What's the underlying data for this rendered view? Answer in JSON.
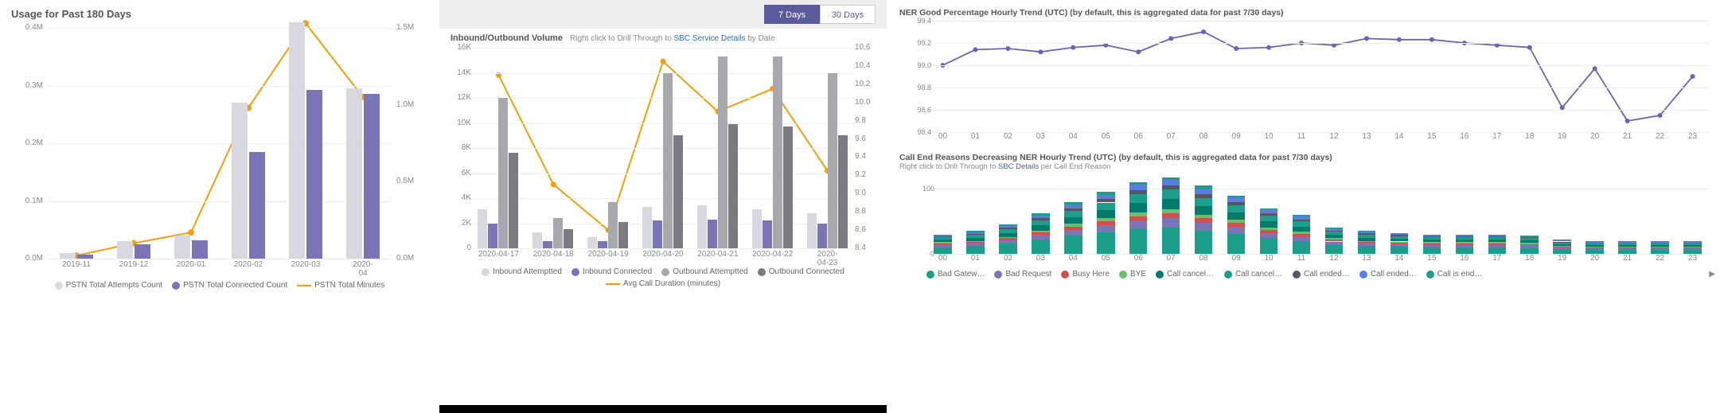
{
  "colors": {
    "barLight": "#d9d7e0",
    "barPurple": "#7b74b7",
    "line": "#f59e0b",
    "greyMid": "#a8a7ae",
    "greyDark": "#7a7a82",
    "teal": "#1b9e8a",
    "tealDark": "#007b6e",
    "red": "#d05050",
    "green": "#6bbf6b",
    "blue": "#5a7dde",
    "yellow": "#e6c13c",
    "slate": "#556",
    "purpleLine": "#6b63b5"
  },
  "panelA": {
    "title": "Usage for Past 180 Days",
    "y_ticks": [
      "0.0M",
      "0.1M",
      "0.2M",
      "0.3M",
      "0.4M"
    ],
    "y2_ticks": [
      "0.0M",
      "0.5M",
      "1.0M",
      "1.5M"
    ],
    "legend": {
      "a": "PSTN Total Attempts Count",
      "b": "PSTN Total Connected Count",
      "c": "PSTN Total Minutes"
    }
  },
  "panelB": {
    "tab1": "7 Days",
    "tab2": "30 Days",
    "title": "Inbound/Outbound Volume",
    "hint_pre": "Right click to Drill Through to",
    "hint_link": "SBC Service Details",
    "hint_post": "by Date",
    "y_ticks": [
      "0",
      "2K",
      "4K",
      "6K",
      "8K",
      "10K",
      "12K",
      "14K",
      "16K"
    ],
    "y2_ticks": [
      "8.4",
      "8.6",
      "8.8",
      "9.0",
      "9.2",
      "9.4",
      "9.6",
      "9.8",
      "10.0",
      "10.2",
      "10.4",
      "10.6"
    ],
    "legend": {
      "a": "Inbound Attemptted",
      "b": "Inbound Connected",
      "c": "Outbound Attemptted",
      "d": "Outbound Connected",
      "e": "Avg Call Duration (minutes)"
    }
  },
  "panelC1": {
    "title": "NER Good Percentage Hourly Trend (UTC) (by default, this is aggregated data for past 7/30 days)",
    "y_ticks": [
      "98.4",
      "98.6",
      "98.8",
      "99.0",
      "99.2",
      "99.4"
    ]
  },
  "panelC2": {
    "title": "Call End Reasons Decreasing NER Hourly Trend (UTC) (by default, this is aggregated data for past 7/30 days)",
    "hint_pre": "Right click to Drill Through to",
    "hint_link": "SBC Details",
    "hint_post": "per Call End Reason",
    "y_ticks": [
      "0",
      "100"
    ],
    "legend_items": [
      "Bad Gatew…",
      "Bad Request",
      "Busy Here",
      "BYE",
      "Call cancell…",
      "Call cancell…",
      "Call ended…",
      "Call ended…",
      "Call is end…"
    ]
  },
  "hours": [
    "00",
    "01",
    "02",
    "03",
    "04",
    "05",
    "06",
    "07",
    "08",
    "09",
    "10",
    "11",
    "12",
    "13",
    "14",
    "15",
    "16",
    "17",
    "18",
    "19",
    "20",
    "21",
    "22",
    "23"
  ],
  "chart_data": [
    {
      "id": "panelA",
      "type": "bar+line",
      "categories": [
        "2019-11",
        "2019-12",
        "2020-01",
        "2020-02",
        "2020-03",
        "2020-04"
      ],
      "y_axis": {
        "label": "",
        "ticks": [
          0,
          0.1,
          0.2,
          0.3,
          0.4
        ],
        "unit": "M",
        "lim": [
          0,
          0.4
        ]
      },
      "y2_axis": {
        "label": "",
        "ticks": [
          0,
          0.5,
          1.0,
          1.5
        ],
        "unit": "M",
        "lim": [
          0,
          1.5
        ]
      },
      "series": [
        {
          "name": "PSTN Total Attempts Count",
          "kind": "bar",
          "axis": "y",
          "color": "#d9d7e0",
          "values": [
            0.01,
            0.03,
            0.04,
            0.27,
            0.41,
            0.295
          ]
        },
        {
          "name": "PSTN Total Connected Count",
          "kind": "bar",
          "axis": "y",
          "color": "#7b74b7",
          "values": [
            0.007,
            0.025,
            0.032,
            0.185,
            0.292,
            0.285
          ]
        },
        {
          "name": "PSTN Total Minutes",
          "kind": "line",
          "axis": "y2",
          "color": "#f59e0b",
          "values": [
            0.02,
            0.1,
            0.17,
            0.98,
            1.53,
            1.05
          ]
        }
      ]
    },
    {
      "id": "panelB",
      "type": "bar+line",
      "categories": [
        "2020-04-17",
        "2020-04-18",
        "2020-04-19",
        "2020-04-20",
        "2020-04-21",
        "2020-04-22",
        "2020-04-23"
      ],
      "y_axis": {
        "label": "",
        "ticks": [
          0,
          2000,
          4000,
          6000,
          8000,
          10000,
          12000,
          14000,
          16000
        ],
        "unit": "K",
        "lim": [
          0,
          16000
        ]
      },
      "y2_axis": {
        "label": "",
        "ticks": [
          8.4,
          8.6,
          8.8,
          9.0,
          9.2,
          9.4,
          9.6,
          9.8,
          10.0,
          10.2,
          10.4,
          10.6
        ],
        "lim": [
          8.4,
          10.6
        ]
      },
      "series": [
        {
          "name": "Inbound Attemptted",
          "kind": "bar",
          "axis": "y",
          "color": "#d9d7e0",
          "values": [
            3100,
            1300,
            900,
            3300,
            3400,
            3100,
            2800
          ]
        },
        {
          "name": "Inbound Connected",
          "kind": "bar",
          "axis": "y",
          "color": "#7b74b7",
          "values": [
            2000,
            550,
            600,
            2200,
            2300,
            2200,
            2000
          ]
        },
        {
          "name": "Outbound Attemptted",
          "kind": "bar",
          "axis": "y",
          "color": "#a8a7ae",
          "values": [
            12000,
            2400,
            3700,
            14000,
            15300,
            15300,
            14000
          ]
        },
        {
          "name": "Outbound Connected",
          "kind": "bar",
          "axis": "y",
          "color": "#7a7a82",
          "values": [
            7600,
            1500,
            2100,
            9000,
            9900,
            9700,
            9000
          ]
        },
        {
          "name": "Avg Call Duration (minutes)",
          "kind": "line",
          "axis": "y2",
          "color": "#f59e0b",
          "values": [
            10.3,
            9.1,
            8.6,
            10.45,
            9.9,
            10.15,
            9.25
          ]
        }
      ]
    },
    {
      "id": "panelC1",
      "type": "line",
      "x": [
        0,
        1,
        2,
        3,
        4,
        5,
        6,
        7,
        8,
        9,
        10,
        11,
        12,
        13,
        14,
        15,
        16,
        17,
        18,
        19,
        20,
        21,
        22,
        23
      ],
      "y_axis": {
        "lim": [
          98.4,
          99.4
        ],
        "ticks": [
          98.4,
          98.6,
          98.8,
          99.0,
          99.2,
          99.4
        ]
      },
      "series": [
        {
          "name": "NER Good %",
          "kind": "line",
          "color": "#6b63b5",
          "values": [
            99.0,
            99.14,
            99.15,
            99.12,
            99.16,
            99.18,
            99.12,
            99.24,
            99.3,
            99.15,
            99.16,
            99.2,
            99.18,
            99.24,
            99.23,
            99.23,
            99.2,
            99.18,
            99.16,
            98.62,
            98.97,
            98.5,
            98.55,
            98.9
          ]
        }
      ]
    },
    {
      "id": "panelC2",
      "type": "stacked-bar",
      "x": [
        0,
        1,
        2,
        3,
        4,
        5,
        6,
        7,
        8,
        9,
        10,
        11,
        12,
        13,
        14,
        15,
        16,
        17,
        18,
        19,
        20,
        21,
        22,
        23
      ],
      "y_axis": {
        "lim": [
          0,
          120
        ],
        "ticks": [
          0,
          100
        ]
      },
      "reasons": [
        "Bad Gateway",
        "Bad Request",
        "Busy Here",
        "BYE",
        "Call cancelled A",
        "Call cancelled B",
        "Call ended A",
        "Call ended B",
        "Call is ended"
      ],
      "colors": [
        "#1b9e8a",
        "#7b74b7",
        "#d05050",
        "#6bbf6b",
        "#007b6e",
        "#1b9e8a",
        "#556",
        "#5a7dde",
        "#1b9e8a"
      ],
      "totals": [
        30,
        35,
        45,
        62,
        80,
        95,
        110,
        118,
        105,
        90,
        70,
        60,
        40,
        35,
        32,
        30,
        30,
        30,
        28,
        22,
        20,
        20,
        20,
        20
      ],
      "segments": [
        [
          10,
          4,
          2,
          2,
          4,
          4,
          1,
          2,
          1
        ],
        [
          12,
          4,
          2,
          2,
          5,
          5,
          1,
          2,
          2
        ],
        [
          16,
          5,
          3,
          2,
          6,
          6,
          2,
          3,
          2
        ],
        [
          22,
          7,
          4,
          3,
          8,
          8,
          3,
          4,
          3
        ],
        [
          28,
          9,
          5,
          4,
          10,
          10,
          4,
          6,
          4
        ],
        [
          33,
          11,
          6,
          5,
          12,
          12,
          5,
          7,
          4
        ],
        [
          38,
          13,
          7,
          6,
          14,
          14,
          6,
          8,
          4
        ],
        [
          41,
          14,
          8,
          6,
          15,
          15,
          6,
          9,
          4
        ],
        [
          36,
          12,
          7,
          5,
          13,
          13,
          6,
          8,
          5
        ],
        [
          31,
          11,
          6,
          5,
          11,
          11,
          5,
          7,
          3
        ],
        [
          24,
          8,
          5,
          4,
          9,
          9,
          4,
          5,
          2
        ],
        [
          20,
          7,
          4,
          3,
          8,
          8,
          3,
          5,
          2
        ],
        [
          14,
          5,
          3,
          2,
          5,
          5,
          2,
          3,
          1
        ],
        [
          12,
          4,
          2,
          2,
          5,
          5,
          2,
          2,
          1
        ],
        [
          11,
          4,
          2,
          2,
          4,
          4,
          2,
          2,
          1
        ],
        [
          10,
          4,
          2,
          2,
          4,
          4,
          1,
          2,
          1
        ],
        [
          10,
          4,
          2,
          2,
          4,
          4,
          1,
          2,
          1
        ],
        [
          10,
          4,
          2,
          2,
          4,
          4,
          1,
          2,
          1
        ],
        [
          9,
          4,
          2,
          2,
          4,
          4,
          1,
          1,
          1
        ],
        [
          7,
          3,
          1,
          1,
          3,
          3,
          1,
          2,
          1
        ],
        [
          6,
          3,
          1,
          1,
          3,
          3,
          1,
          1,
          1
        ],
        [
          6,
          3,
          1,
          1,
          3,
          3,
          1,
          1,
          1
        ],
        [
          6,
          3,
          1,
          1,
          3,
          3,
          1,
          1,
          1
        ],
        [
          6,
          3,
          1,
          1,
          3,
          3,
          1,
          1,
          1
        ]
      ]
    }
  ]
}
